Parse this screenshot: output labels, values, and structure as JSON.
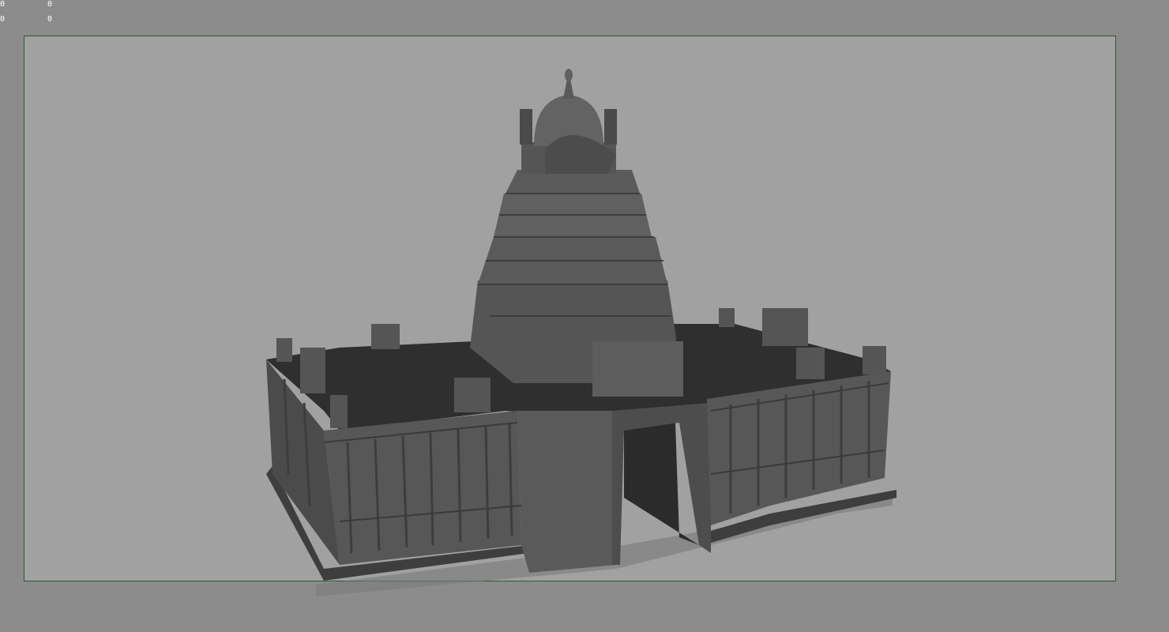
{
  "viewport": {
    "hud_values": [
      {
        "id": "hud-top-left-1",
        "text": "0"
      },
      {
        "id": "hud-top-left-2",
        "text": "0"
      },
      {
        "id": "hud-top-left-3",
        "text": "0"
      },
      {
        "id": "hud-top-left-4",
        "text": "0"
      }
    ],
    "colors": {
      "outer_background": "#8c8c8c",
      "gate_background": "#a1a1a1",
      "gate_border": "#2e5a2e",
      "model_dark": "#2f2f2f",
      "model_mid": "#4a4a4a",
      "model_light": "#5c5c5c"
    },
    "model": {
      "subject": "temple-3d-model"
    }
  }
}
